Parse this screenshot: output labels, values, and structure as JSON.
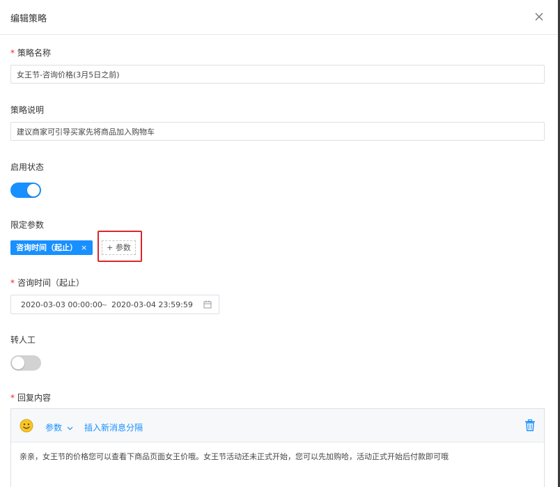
{
  "dialog": {
    "title": "编辑策略"
  },
  "form": {
    "required_mark": "*",
    "name": {
      "label": "策略名称",
      "value": "女王节-咨询价格(3月5日之前)"
    },
    "description": {
      "label": "策略说明",
      "value": "建议商家可引导买家先将商品加入购物车"
    },
    "status": {
      "label": "启用状态",
      "enabled": true
    },
    "params": {
      "label": "限定参数",
      "tags": [
        {
          "label": "咨询时间（起止）",
          "close": "×"
        }
      ],
      "add_label": "+ 参数"
    },
    "consult_time": {
      "label": "咨询时间（起止）",
      "start": "2020-03-03 00:00:00",
      "separator": "~",
      "end": "2020-03-04 23:59:59"
    },
    "transfer": {
      "label": "转人工",
      "enabled": false
    },
    "reply": {
      "label": "回复内容",
      "toolbar": {
        "emoji_icon": "smiley-icon",
        "param_label": "参数",
        "insert_label": "插入新消息分隔",
        "delete_icon": "trash-icon"
      },
      "content": "亲亲，女王节的价格您可以查看下商品页面女王价哦。女王节活动还未正式开始，您可以先加购哈，活动正式开始后付款即可哦"
    }
  },
  "colors": {
    "primary": "#1890ff",
    "required": "#f5222d",
    "highlight_box": "#d9262c"
  }
}
